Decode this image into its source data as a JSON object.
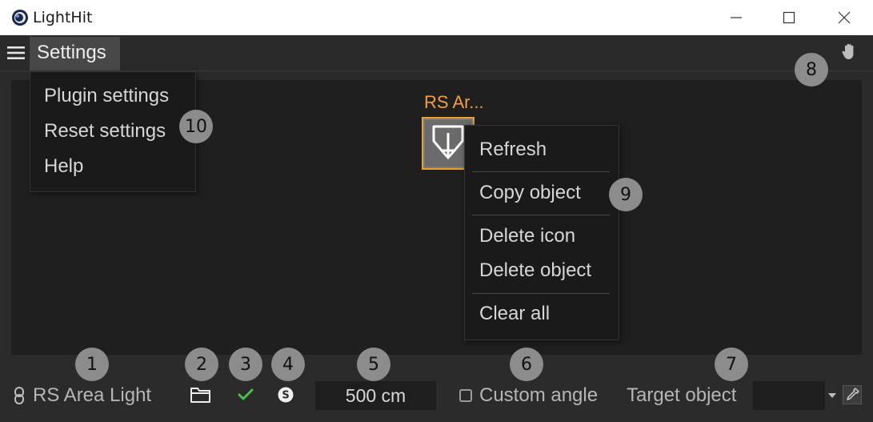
{
  "window": {
    "title": "LightHit"
  },
  "menubar": {
    "settings_label": "Settings"
  },
  "settings_menu": {
    "items": [
      "Plugin settings",
      "Reset settings",
      "Help"
    ]
  },
  "light": {
    "name": "RS Ar..."
  },
  "context_menu": {
    "items": [
      "Refresh",
      "Copy object",
      "Delete icon",
      "Delete object",
      "Clear all"
    ]
  },
  "bottom": {
    "light_type": "RS Area Light",
    "radius": "500 cm",
    "custom_angle_label": "Custom angle",
    "custom_angle_checked": false,
    "target_label": "Target object",
    "target_value": ""
  },
  "badges": [
    "1",
    "2",
    "3",
    "4",
    "5",
    "6",
    "7",
    "8",
    "9",
    "10"
  ],
  "colors": {
    "accent_orange": "#e8a030",
    "check_green": "#4cc04c",
    "badge_gray": "#8c8c8c"
  },
  "icons": [
    "cinema4d-logo-icon",
    "minimize-icon",
    "maximize-icon",
    "close-icon",
    "hamburger-icon",
    "hand-icon",
    "area-light-icon",
    "link-icon",
    "folder-icon",
    "checkmark-icon",
    "s-circle-icon",
    "dropdown-arrow-icon",
    "eyedropper-icon"
  ]
}
